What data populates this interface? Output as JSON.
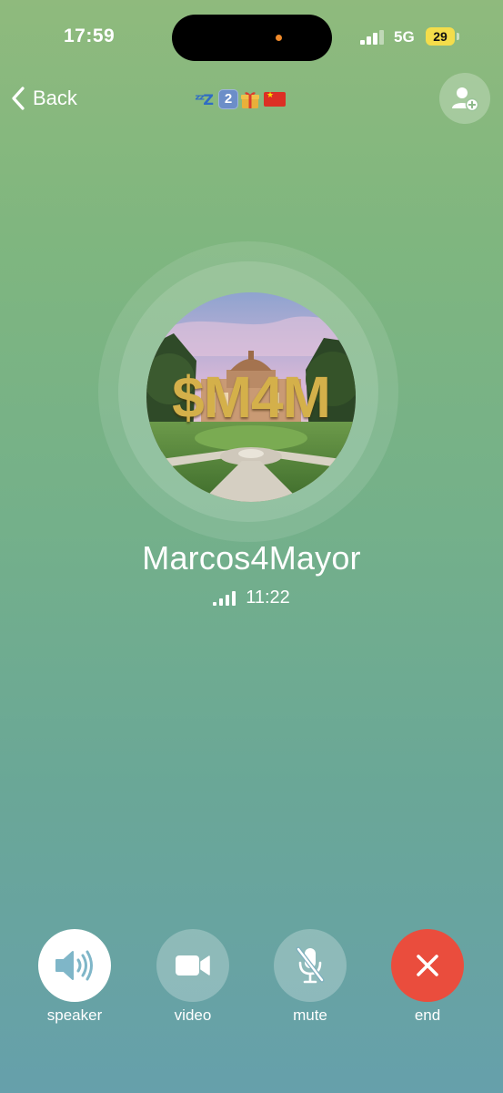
{
  "status_bar": {
    "time": "17:59",
    "network": "5G",
    "battery": "29"
  },
  "nav": {
    "back_label": "Back",
    "title_emoji": [
      "zzz",
      "2",
      "gift",
      "flag-china"
    ]
  },
  "call": {
    "caller_name": "Marcos4Mayor",
    "avatar_text": "$M4M",
    "duration": "11:22"
  },
  "controls": {
    "speaker_label": "speaker",
    "video_label": "video",
    "mute_label": "mute",
    "end_label": "end"
  },
  "colors": {
    "end_button": "#ea4d3d",
    "battery": "#f4dd4b",
    "avatar_text": "#d4b04a"
  },
  "icons": {
    "signal": "signal-icon",
    "back": "chevron-left-icon",
    "add_contact": "add-contact-icon",
    "speaker": "speaker-icon",
    "video": "video-camera-icon",
    "mute": "microphone-off-icon",
    "end": "close-icon"
  }
}
